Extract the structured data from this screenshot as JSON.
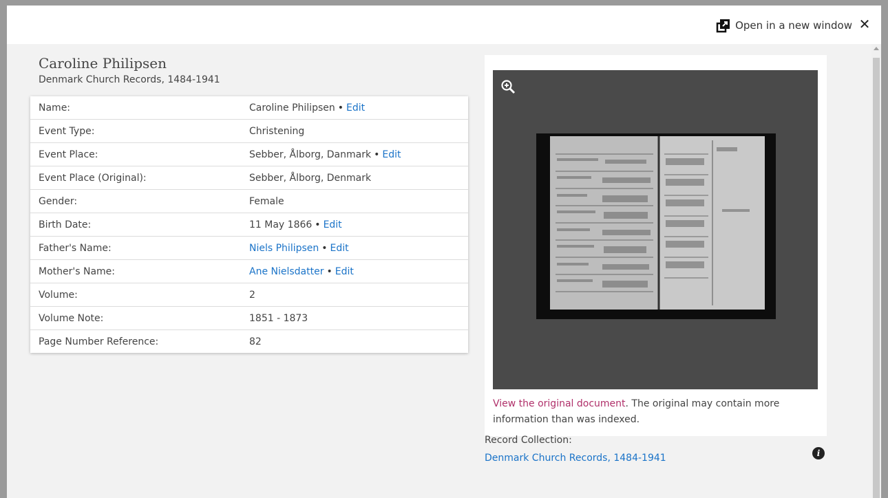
{
  "header": {
    "open_new_window_label": "Open in a new window",
    "close_label": "✕"
  },
  "record": {
    "name": "Caroline Philipsen",
    "collection": "Denmark Church Records, 1484-1941"
  },
  "facts": [
    {
      "label": "Name:",
      "value": "Caroline Philipsen",
      "edit": "Edit",
      "value_is_link": false
    },
    {
      "label": "Event Type:",
      "value": "Christening",
      "edit": null,
      "value_is_link": false
    },
    {
      "label": "Event Place:",
      "value": "Sebber, Ålborg, Danmark",
      "edit": "Edit",
      "value_is_link": false
    },
    {
      "label": "Event Place (Original):",
      "value": "Sebber, Ålborg, Denmark",
      "edit": null,
      "value_is_link": false
    },
    {
      "label": "Gender:",
      "value": "Female",
      "edit": null,
      "value_is_link": false
    },
    {
      "label": "Birth Date:",
      "value": "11 May 1866",
      "edit": "Edit",
      "value_is_link": false
    },
    {
      "label": "Father's Name:",
      "value": "Niels Philipsen",
      "edit": "Edit",
      "value_is_link": true
    },
    {
      "label": "Mother's Name:",
      "value": "Ane Nielsdatter",
      "edit": "Edit",
      "value_is_link": true
    },
    {
      "label": "Volume:",
      "value": "2",
      "edit": null,
      "value_is_link": false
    },
    {
      "label": "Volume Note:",
      "value": "1851 - 1873",
      "edit": null,
      "value_is_link": false
    },
    {
      "label": "Page Number Reference:",
      "value": "82",
      "edit": null,
      "value_is_link": false
    }
  ],
  "image": {
    "view_original_link": "View the original document",
    "caption_rest": ". The original may contain more information than was indexed."
  },
  "record_collection": {
    "label": "Record Collection:",
    "link": "Denmark Church Records, 1484-1941"
  },
  "icons": {
    "open_new": "open-new-window-icon",
    "close": "close-icon",
    "zoom": "zoom-in-icon",
    "info": "info-icon"
  },
  "colors": {
    "link": "#1a73c8",
    "original_link": "#b0306a",
    "viewer_bg": "#4a4a4a"
  }
}
